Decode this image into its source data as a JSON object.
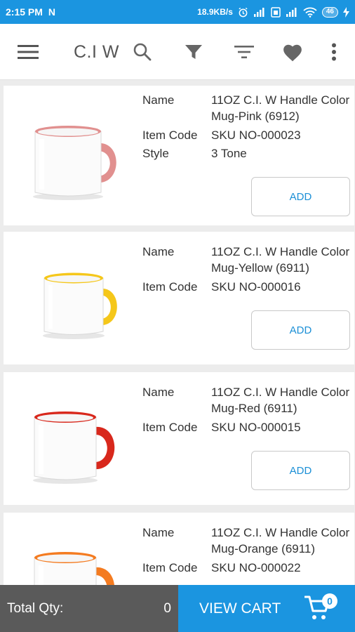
{
  "status_bar": {
    "time": "2:15 PM",
    "n_glyph": "N",
    "net_speed": "18.9KB/s",
    "battery": "46"
  },
  "toolbar": {
    "brand": "C.I W",
    "icons": [
      "menu-icon",
      "search-icon",
      "filter-icon",
      "sort-icon",
      "heart-icon",
      "more-vert-icon"
    ]
  },
  "labels": {
    "name": "Name",
    "item_code": "Item Code",
    "style": "Style",
    "add": "ADD"
  },
  "products": [
    {
      "name": "11OZ C.I. W Handle Color Mug-Pink (6912)",
      "item_code": "SKU NO-000023",
      "style": "3 Tone",
      "color": "#e1908f"
    },
    {
      "name": "11OZ C.I. W Handle Color Mug-Yellow (6911)",
      "item_code": "SKU NO-000016",
      "color": "#f5c71a"
    },
    {
      "name": "11OZ C.I. W Handle Color Mug-Red (6911)",
      "item_code": "SKU NO-000015",
      "color": "#d8281c"
    },
    {
      "name": "11OZ C.I. W Handle Color Mug-Orange (6911)",
      "item_code": "SKU NO-000022",
      "color": "#f47b20"
    }
  ],
  "bottom": {
    "total_label": "Total Qty:",
    "total_qty": "0",
    "view_cart": "VIEW CART",
    "cart_count": "0"
  },
  "colors": {
    "accent": "#1b95e0",
    "bottom_dark": "#5a5a5a"
  }
}
